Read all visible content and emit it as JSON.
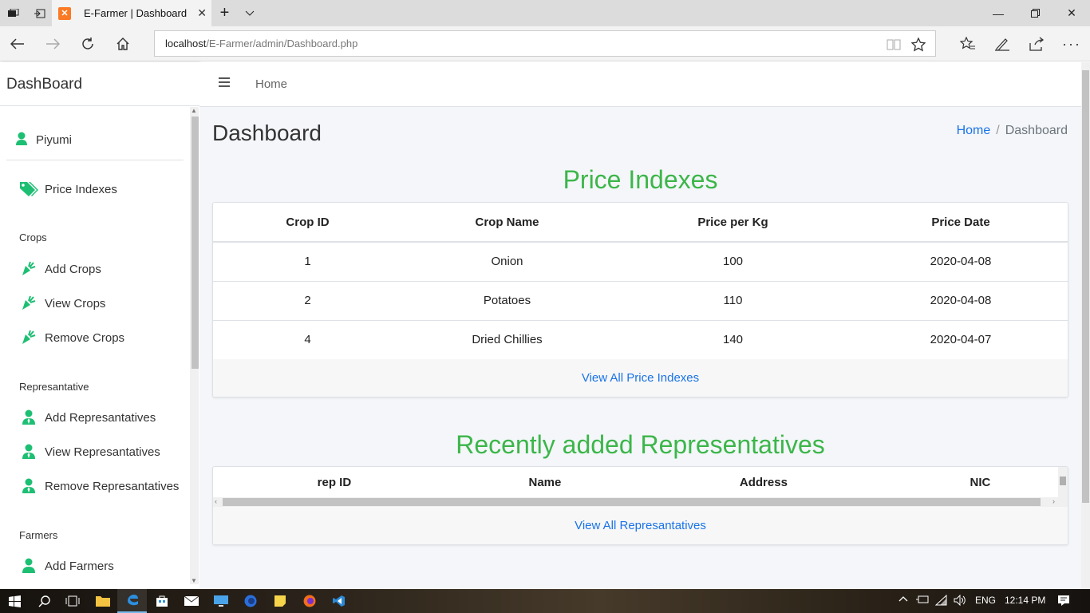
{
  "browser": {
    "tab_title": "E-Farmer | Dashboard",
    "url_host": "localhost",
    "url_path": "/E-Farmer/admin/Dashboard.php"
  },
  "sidebar": {
    "brand": "DashBoard",
    "user": "Piyumi",
    "price_indexes": "Price Indexes",
    "crops_header": "Crops",
    "crops_items": [
      "Add Crops",
      "View Crops",
      "Remove Crops"
    ],
    "rep_header": "Represantative",
    "rep_items": [
      "Add Represantatives",
      "View Represantatives",
      "Remove Represantatives"
    ],
    "farmers_header": "Farmers",
    "farmers_items": [
      "Add Farmers"
    ]
  },
  "topnav": {
    "home": "Home"
  },
  "page": {
    "title": "Dashboard",
    "breadcrumb_home": "Home",
    "breadcrumb_sep": "/",
    "breadcrumb_current": "Dashboard"
  },
  "price_section": {
    "title": "Price Indexes",
    "columns": [
      "Crop ID",
      "Crop Name",
      "Price per Kg",
      "Price Date"
    ],
    "rows": [
      [
        "1",
        "Onion",
        "100",
        "2020-04-08"
      ],
      [
        "2",
        "Potatoes",
        "110",
        "2020-04-08"
      ],
      [
        "4",
        "Dried Chillies",
        "140",
        "2020-04-07"
      ]
    ],
    "footer_link": "View All Price Indexes"
  },
  "rep_section": {
    "title": "Recently added Representatives",
    "columns": [
      "rep ID",
      "Name",
      "Address",
      "NIC"
    ],
    "footer_link": "View All Represantatives"
  },
  "taskbar": {
    "lang": "ENG",
    "time": "12:14 PM"
  },
  "colors": {
    "accent_green": "#3cb64a",
    "link_blue": "#1a73e8",
    "icon_green": "#1dbf73"
  }
}
